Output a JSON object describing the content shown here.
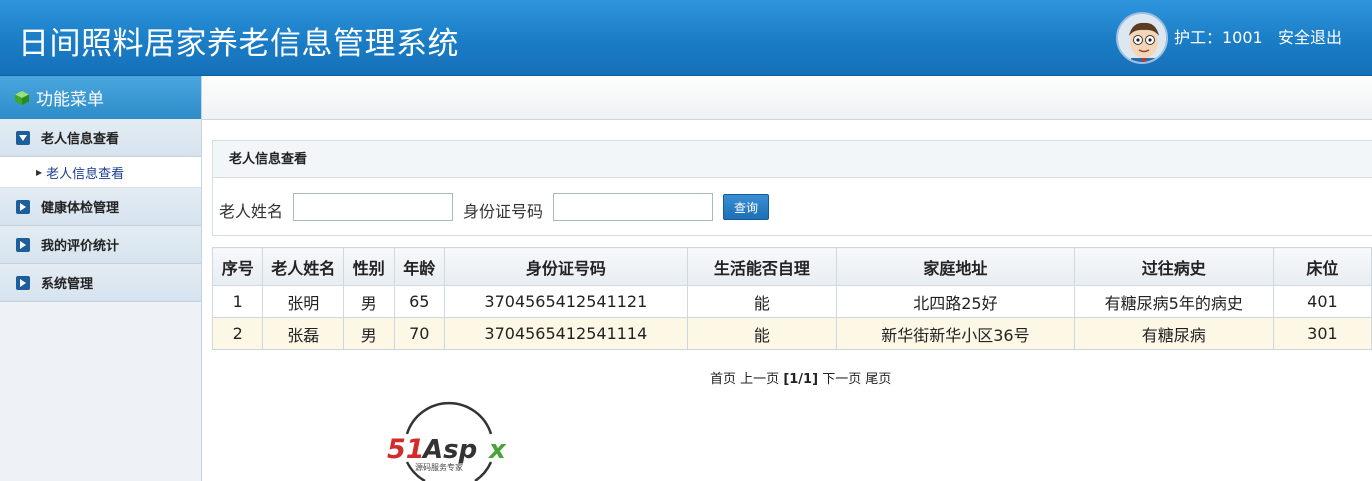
{
  "header": {
    "title": "日间照料居家养老信息管理系统",
    "user_label": "护工：1001",
    "logout_label": "安全退出"
  },
  "sidebar": {
    "title": "功能菜单",
    "sections": [
      {
        "label": "老人信息查看",
        "expanded": true,
        "children": [
          {
            "label": "老人信息查看"
          }
        ]
      },
      {
        "label": "健康体检管理",
        "expanded": false
      },
      {
        "label": "我的评价统计",
        "expanded": false
      },
      {
        "label": "系统管理",
        "expanded": false
      }
    ]
  },
  "panel": {
    "title": "老人信息查看"
  },
  "search": {
    "name_label": "老人姓名",
    "name_value": "",
    "id_label": "身份证号码",
    "id_value": "",
    "button_label": "查询"
  },
  "table": {
    "columns": [
      "序号",
      "老人姓名",
      "性别",
      "年龄",
      "身份证号码",
      "生活能否自理",
      "家庭地址",
      "过往病史",
      "床位"
    ],
    "rows": [
      [
        "1",
        "张明",
        "男",
        "65",
        "3704565412541121",
        "能",
        "北四路25好",
        "有糖尿病5年的病史",
        "401"
      ],
      [
        "2",
        "张磊",
        "男",
        "70",
        "3704565412541114",
        "能",
        "新华街新华小区36号",
        "有糖尿病",
        "301"
      ]
    ]
  },
  "pager": {
    "first": "首页",
    "prev": "上一页",
    "status": "[1/1]",
    "next": "下一页",
    "last": "尾页"
  },
  "watermark": {
    "brand": "51Aspx",
    "tagline": "源码服务专家"
  },
  "colors": {
    "header_blue": "#1a7dc6",
    "menu_square": "#1d5f9a",
    "alt_row": "#fdf8e6"
  }
}
